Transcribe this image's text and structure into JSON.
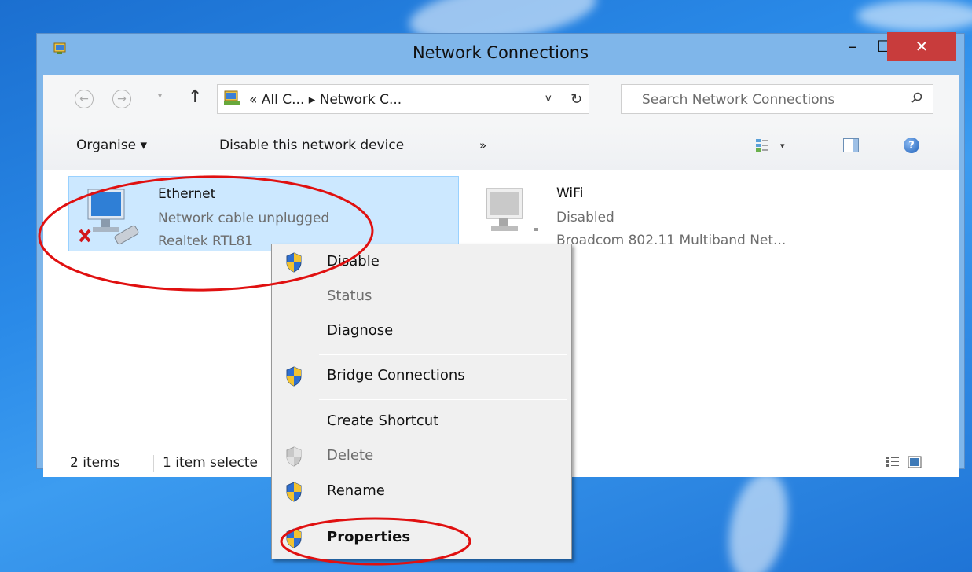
{
  "window": {
    "title": "Network Connections",
    "minimize_glyph": "–",
    "maximize_glyph": "☐",
    "close_glyph": "✕"
  },
  "address": {
    "back_glyph": "←",
    "forward_glyph": "→",
    "up_glyph": "↑",
    "dropdown_glyph": "▾",
    "path": "« All C... ▸ Network C...",
    "chevron_glyph": "v",
    "refresh_glyph": "↻"
  },
  "search": {
    "placeholder": "Search Network Connections"
  },
  "commands": {
    "organise": "Organise ▾",
    "disable_device": "Disable this network device",
    "more": "»",
    "view_dropdown": "▾",
    "help_glyph": "?"
  },
  "connections": [
    {
      "name": "Ethernet",
      "status": "Network cable unplugged",
      "device": "Realtek RTL81",
      "selected": true
    },
    {
      "name": "WiFi",
      "status": "Disabled",
      "device": "Broadcom 802.11 Multiband Net...",
      "selected": false
    }
  ],
  "statusbar": {
    "count": "2 items",
    "selection": "1 item selecte"
  },
  "context_menu": {
    "items": [
      {
        "label": "Disable",
        "shield": true,
        "enabled": true
      },
      {
        "label": "Status",
        "shield": false,
        "enabled": false
      },
      {
        "label": "Diagnose",
        "shield": false,
        "enabled": true
      },
      {
        "label": "Bridge Connections",
        "shield": true,
        "enabled": true
      },
      {
        "label": "Create Shortcut",
        "shield": false,
        "enabled": true
      },
      {
        "label": "Delete",
        "shield": true,
        "enabled": false
      },
      {
        "label": "Rename",
        "shield": true,
        "enabled": true
      },
      {
        "label": "Properties",
        "shield": true,
        "enabled": true,
        "bold": true
      }
    ]
  },
  "colors": {
    "selection": "#cce8ff",
    "close_button": "#c83c3c",
    "annotation": "#e01010"
  }
}
